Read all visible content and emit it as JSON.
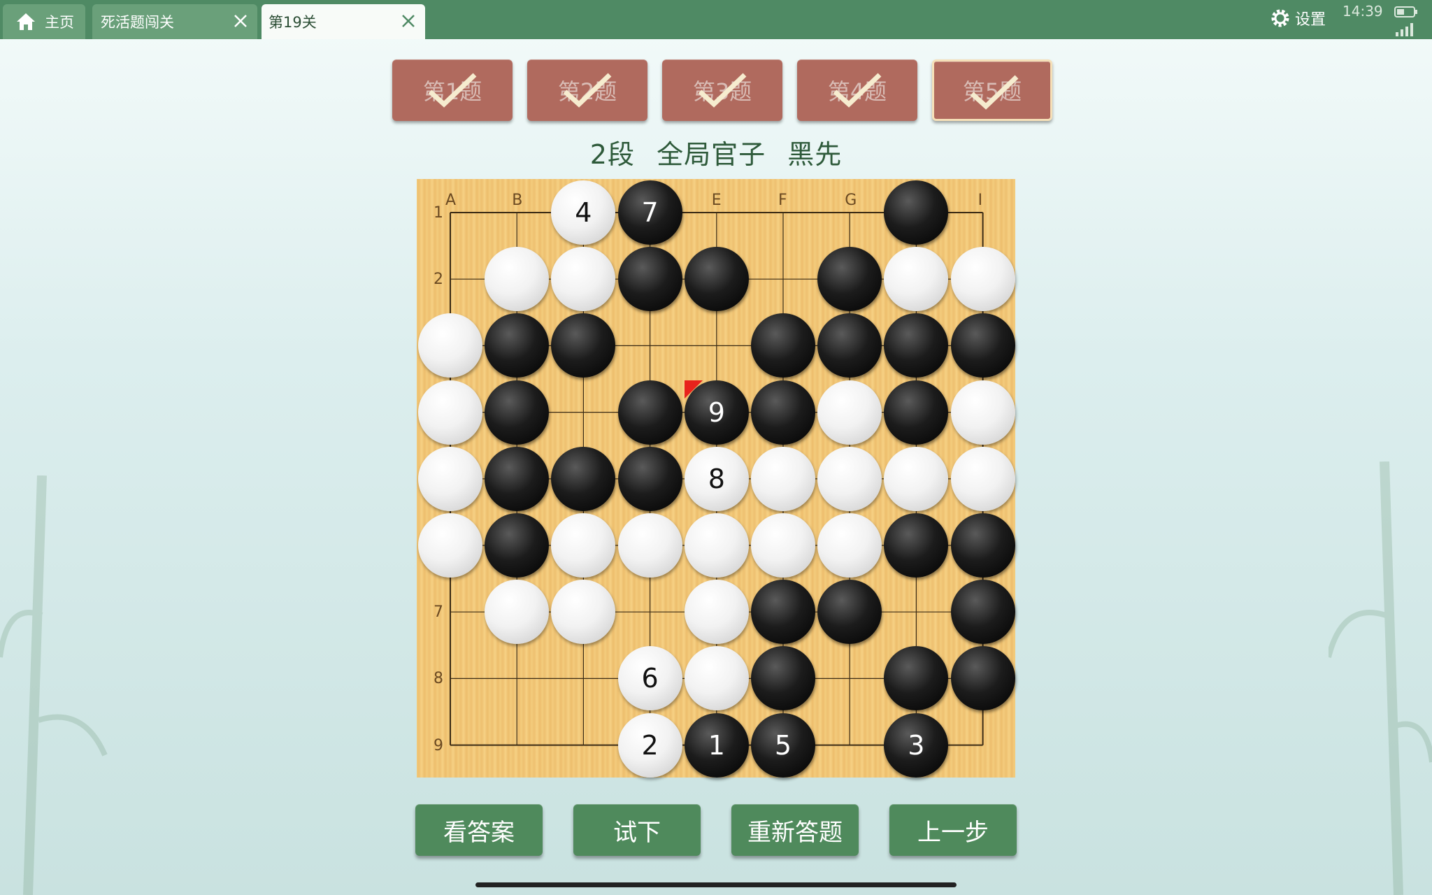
{
  "tabs": {
    "home": {
      "label": "主页",
      "icon": "home-icon"
    },
    "tab2": {
      "label": "死活题闯关",
      "close_icon": "close-icon"
    },
    "tab3": {
      "label": "第19关",
      "close_icon": "close-icon"
    }
  },
  "status": {
    "settings_label": "设置",
    "settings_icon": "gear-icon",
    "time": "14:39",
    "battery_icon": "battery-icon",
    "signal_icon": "signal-icon"
  },
  "levels": [
    {
      "label": "第1题",
      "completed": true
    },
    {
      "label": "第2题",
      "completed": true
    },
    {
      "label": "第3题",
      "completed": true
    },
    {
      "label": "第4题",
      "completed": true
    },
    {
      "label": "第5题",
      "completed": true,
      "selected": true
    }
  ],
  "problem": {
    "rank": "2段",
    "type": "全局官子",
    "to_play": "黑先"
  },
  "board": {
    "size": 9,
    "col_labels": [
      "A",
      "B",
      "",
      "",
      "E",
      "F",
      "G",
      "",
      "I"
    ],
    "row_labels": [
      "1",
      "2",
      "",
      "",
      "",
      "",
      "7",
      "8",
      "9"
    ],
    "last_move": "E4",
    "stones": [
      {
        "pt": "C1",
        "color": "white",
        "num": "4"
      },
      {
        "pt": "D1",
        "color": "black",
        "num": "7"
      },
      {
        "pt": "H1",
        "color": "black",
        "num": ""
      },
      {
        "pt": "B2",
        "color": "white",
        "num": ""
      },
      {
        "pt": "C2",
        "color": "white",
        "num": ""
      },
      {
        "pt": "D2",
        "color": "black",
        "num": ""
      },
      {
        "pt": "E2",
        "color": "black",
        "num": ""
      },
      {
        "pt": "G2",
        "color": "black",
        "num": ""
      },
      {
        "pt": "H2",
        "color": "white",
        "num": ""
      },
      {
        "pt": "I2",
        "color": "white",
        "num": ""
      },
      {
        "pt": "A3",
        "color": "white",
        "num": ""
      },
      {
        "pt": "B3",
        "color": "black",
        "num": ""
      },
      {
        "pt": "C3",
        "color": "black",
        "num": ""
      },
      {
        "pt": "F3",
        "color": "black",
        "num": ""
      },
      {
        "pt": "G3",
        "color": "black",
        "num": ""
      },
      {
        "pt": "H3",
        "color": "black",
        "num": ""
      },
      {
        "pt": "I3",
        "color": "black",
        "num": ""
      },
      {
        "pt": "A4",
        "color": "white",
        "num": ""
      },
      {
        "pt": "B4",
        "color": "black",
        "num": ""
      },
      {
        "pt": "D4",
        "color": "black",
        "num": ""
      },
      {
        "pt": "E4",
        "color": "black",
        "num": "9"
      },
      {
        "pt": "F4",
        "color": "black",
        "num": ""
      },
      {
        "pt": "G4",
        "color": "white",
        "num": ""
      },
      {
        "pt": "H4",
        "color": "black",
        "num": ""
      },
      {
        "pt": "I4",
        "color": "white",
        "num": ""
      },
      {
        "pt": "A5",
        "color": "white",
        "num": ""
      },
      {
        "pt": "B5",
        "color": "black",
        "num": ""
      },
      {
        "pt": "C5",
        "color": "black",
        "num": ""
      },
      {
        "pt": "D5",
        "color": "black",
        "num": ""
      },
      {
        "pt": "E5",
        "color": "white",
        "num": "8"
      },
      {
        "pt": "F5",
        "color": "white",
        "num": ""
      },
      {
        "pt": "G5",
        "color": "white",
        "num": ""
      },
      {
        "pt": "H5",
        "color": "white",
        "num": ""
      },
      {
        "pt": "I5",
        "color": "white",
        "num": ""
      },
      {
        "pt": "A6",
        "color": "white",
        "num": ""
      },
      {
        "pt": "B6",
        "color": "black",
        "num": ""
      },
      {
        "pt": "C6",
        "color": "white",
        "num": ""
      },
      {
        "pt": "D6",
        "color": "white",
        "num": ""
      },
      {
        "pt": "E6",
        "color": "white",
        "num": ""
      },
      {
        "pt": "F6",
        "color": "white",
        "num": ""
      },
      {
        "pt": "G6",
        "color": "white",
        "num": ""
      },
      {
        "pt": "H6",
        "color": "black",
        "num": ""
      },
      {
        "pt": "I6",
        "color": "black",
        "num": ""
      },
      {
        "pt": "B7",
        "color": "white",
        "num": ""
      },
      {
        "pt": "C7",
        "color": "white",
        "num": ""
      },
      {
        "pt": "E7",
        "color": "white",
        "num": ""
      },
      {
        "pt": "F7",
        "color": "black",
        "num": ""
      },
      {
        "pt": "G7",
        "color": "black",
        "num": ""
      },
      {
        "pt": "I7",
        "color": "black",
        "num": ""
      },
      {
        "pt": "D8",
        "color": "white",
        "num": "6"
      },
      {
        "pt": "E8",
        "color": "white",
        "num": ""
      },
      {
        "pt": "F8",
        "color": "black",
        "num": ""
      },
      {
        "pt": "H8",
        "color": "black",
        "num": ""
      },
      {
        "pt": "I8",
        "color": "black",
        "num": ""
      },
      {
        "pt": "D9",
        "color": "white",
        "num": "2"
      },
      {
        "pt": "E9",
        "color": "black",
        "num": "1"
      },
      {
        "pt": "F9",
        "color": "black",
        "num": "5"
      },
      {
        "pt": "H9",
        "color": "black",
        "num": "3"
      }
    ]
  },
  "actions": {
    "answer": "看答案",
    "try": "试下",
    "restart": "重新答题",
    "undo": "上一步"
  },
  "colors": {
    "accent": "#4f8a5c",
    "level_button": "#b06a5e",
    "board": "#f2c97a",
    "last_move_marker": "#e8231c"
  }
}
